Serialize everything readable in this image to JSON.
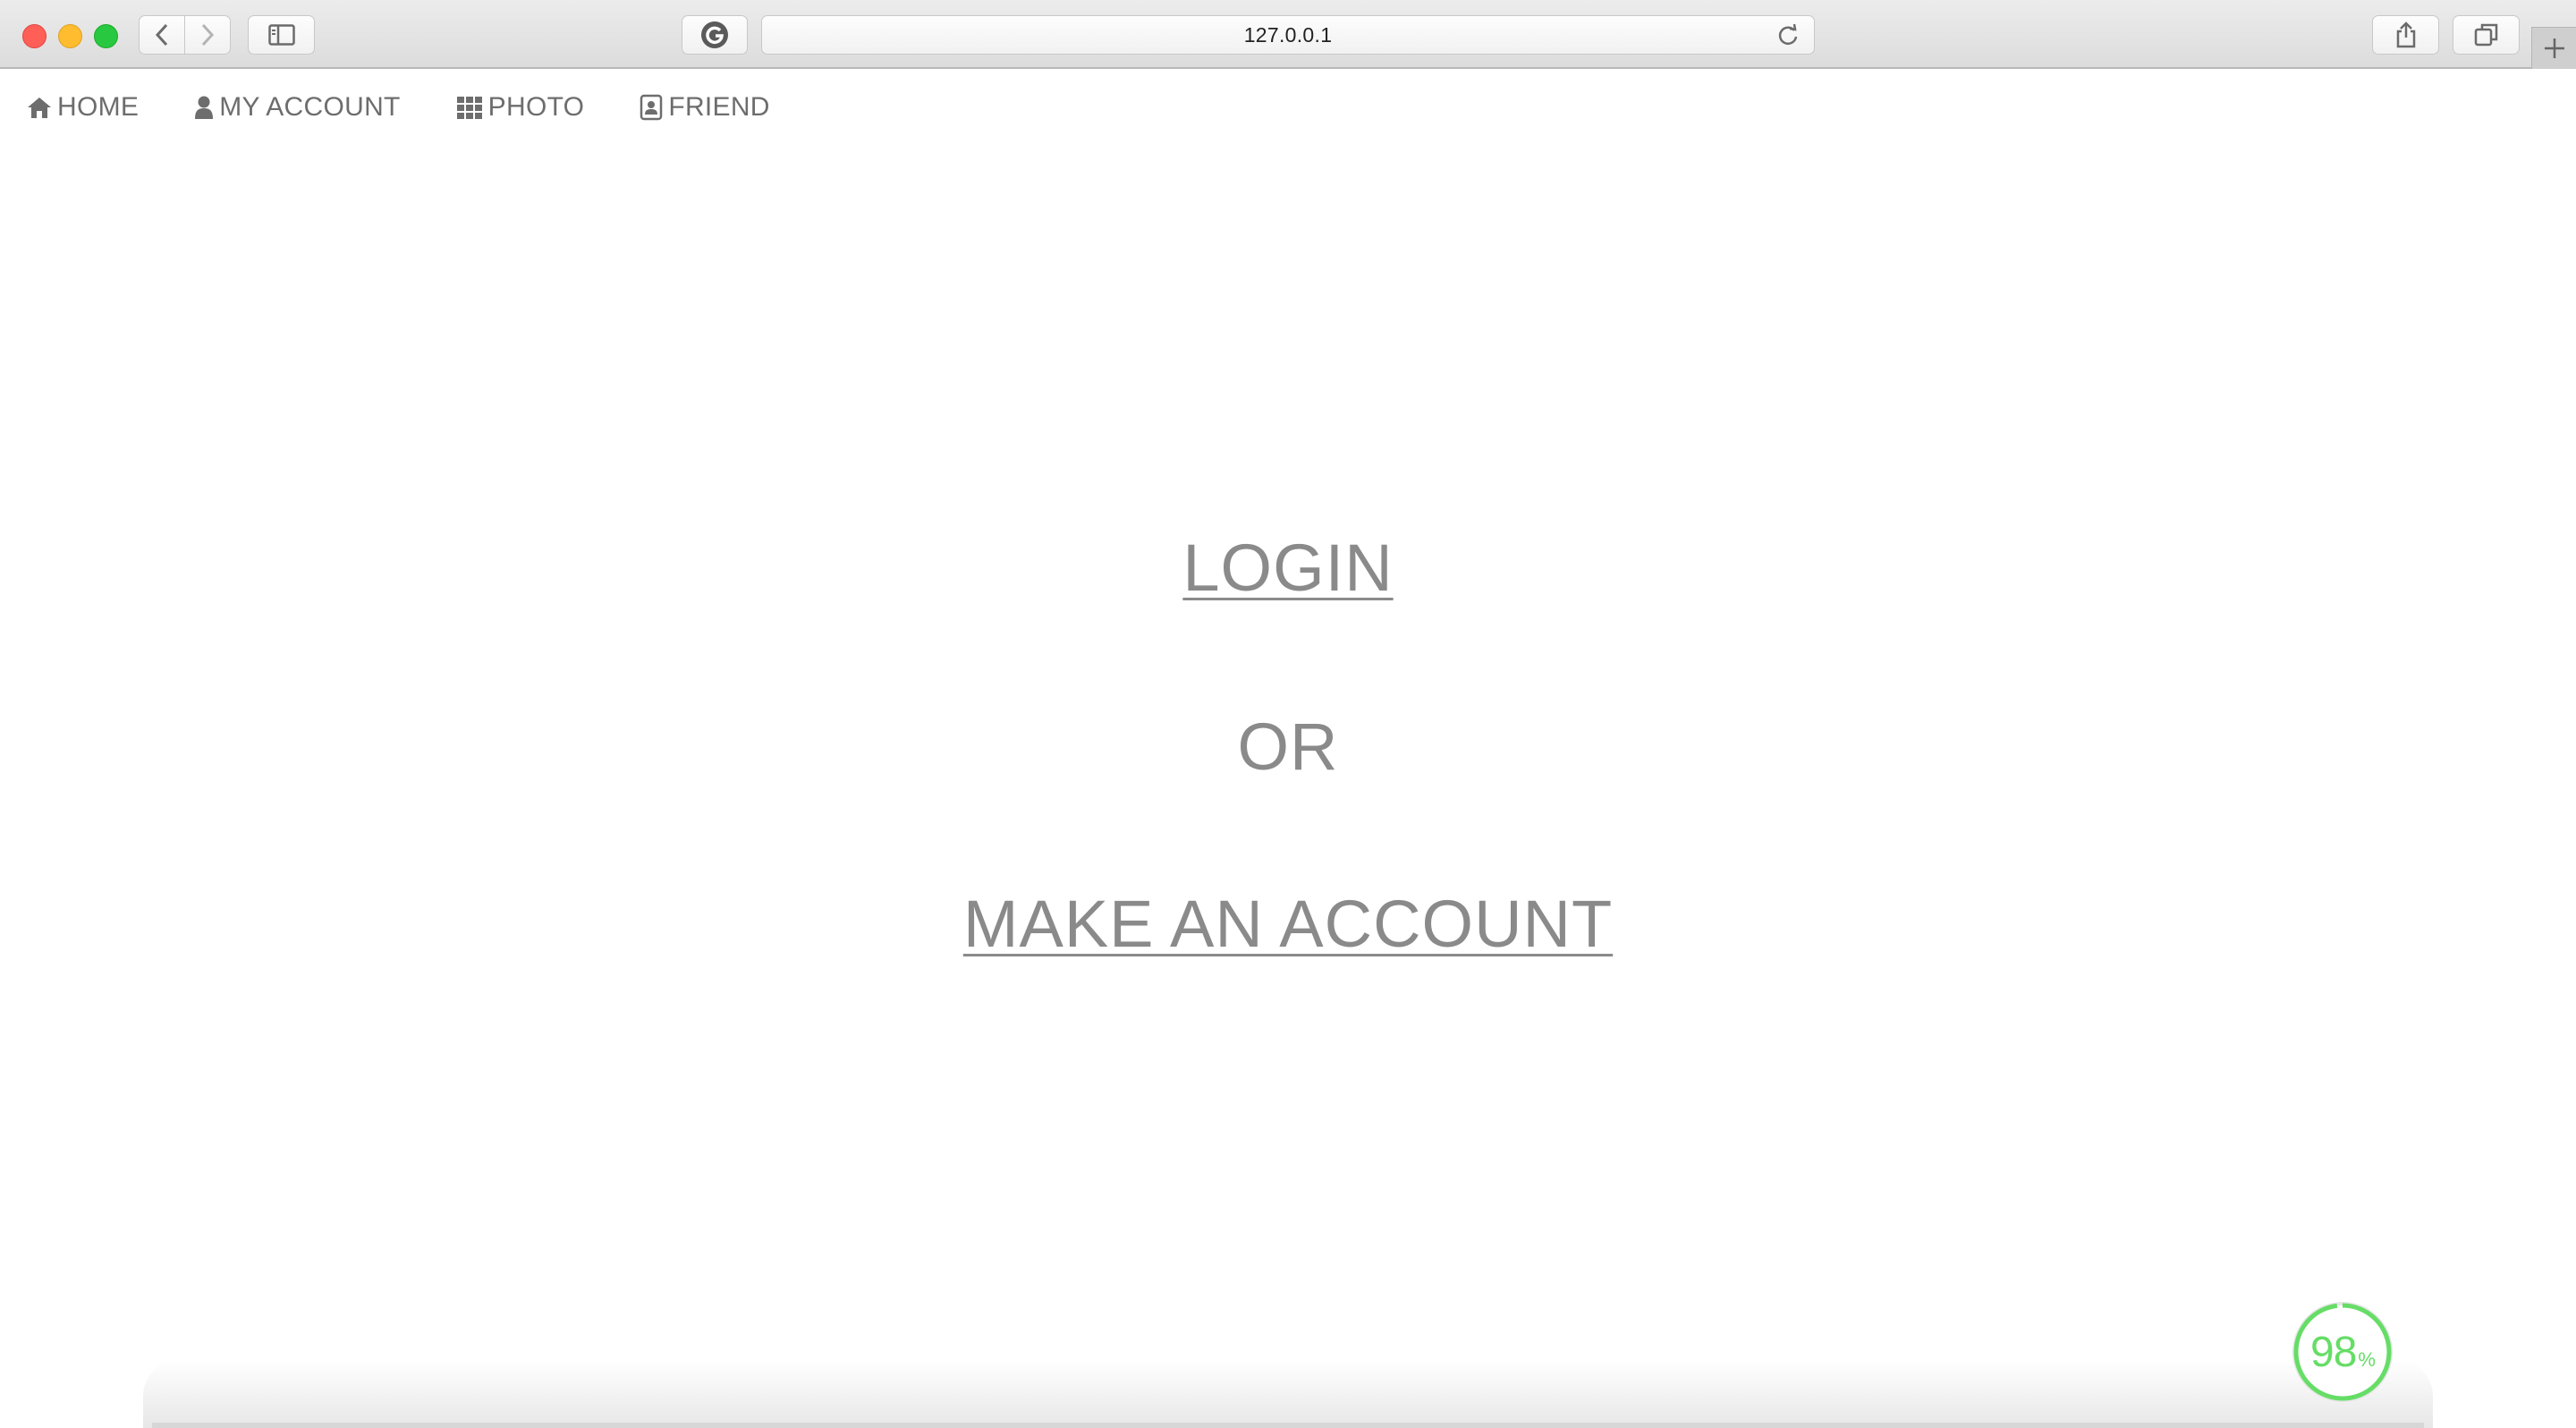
{
  "browser": {
    "address": "127.0.0.1"
  },
  "nav": {
    "items": [
      {
        "label": "HOME",
        "icon": "home-icon"
      },
      {
        "label": "MY ACCOUNT",
        "icon": "user-icon"
      },
      {
        "label": "PHOTO",
        "icon": "grid-icon"
      },
      {
        "label": "FRIEND",
        "icon": "contact-card-icon"
      }
    ]
  },
  "main": {
    "login_label": "LOGIN",
    "or_label": "OR",
    "make_account_label": "MAKE AN ACCOUNT"
  },
  "progress": {
    "value": "98",
    "unit": "%",
    "fraction": 0.98,
    "color": "#66dd66"
  }
}
